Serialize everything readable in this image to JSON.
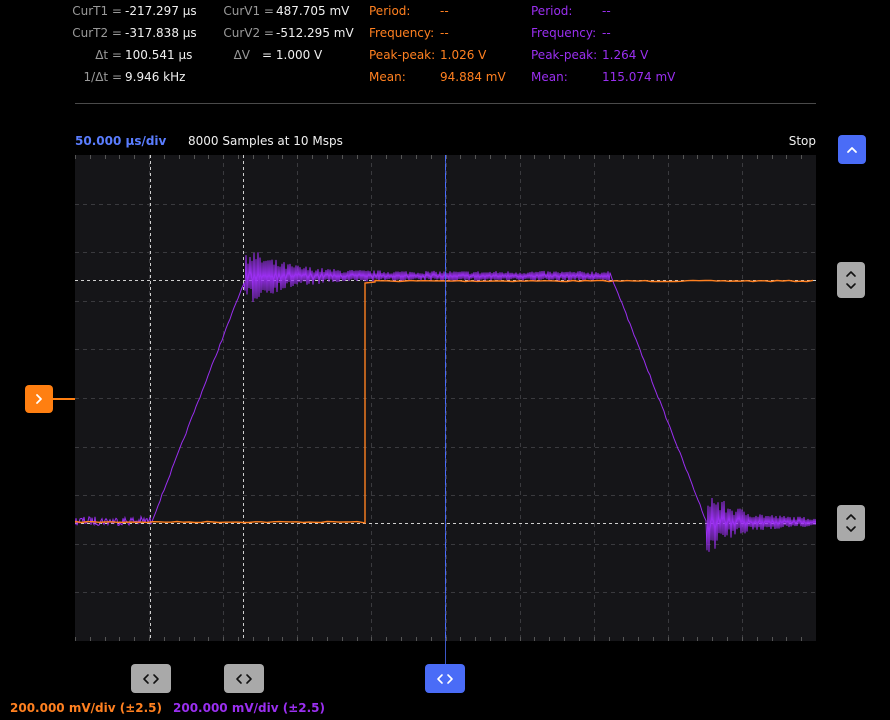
{
  "measurements": {
    "cursors": [
      {
        "label": "CurT1 =",
        "value": "-217.297 µs"
      },
      {
        "label": "CurT2 =",
        "value": "-317.838 µs"
      },
      {
        "label": "Δt =",
        "value": "100.541 µs"
      },
      {
        "label": "1/Δt =",
        "value": "9.946 kHz"
      }
    ],
    "voltage_cursors": [
      {
        "label": "CurV1 =",
        "value": "487.705 mV"
      },
      {
        "label": "CurV2 =",
        "value": "-512.295 mV"
      },
      {
        "label": "ΔV",
        "value": "= 1.000 V"
      }
    ],
    "channel1": [
      {
        "label": "Period:",
        "value": "--"
      },
      {
        "label": "Frequency:",
        "value": "--"
      },
      {
        "label": "Peak-peak:",
        "value": "1.026 V"
      },
      {
        "label": "Mean:",
        "value": "94.884 mV"
      }
    ],
    "channel2": [
      {
        "label": "Period:",
        "value": "--"
      },
      {
        "label": "Frequency:",
        "value": "--"
      },
      {
        "label": "Peak-peak:",
        "value": "1.264 V"
      },
      {
        "label": "Mean:",
        "value": "115.074 mV"
      }
    ]
  },
  "timebase": {
    "scale": "50.000 µs/div",
    "samples": "8000 Samples at 10 Msps",
    "state": "Stop"
  },
  "channels": {
    "ch1_scale": "200.000 mV/div (±2.5)",
    "ch2_scale": "200.000 mV/div (±2.5)"
  },
  "colors": {
    "ch1": "#ff8020",
    "ch2": "#9a2ff0",
    "accent": "#4a6cf7",
    "grid": "#3a3a3e",
    "plot_bg": "#151518"
  },
  "icons": {
    "scroll_up": "chevron-up-icon",
    "cursor_pair": "chevron-left-right-icon",
    "trigger": "chevron-right-icon",
    "level_pair": "chevron-up-down-icon"
  }
}
